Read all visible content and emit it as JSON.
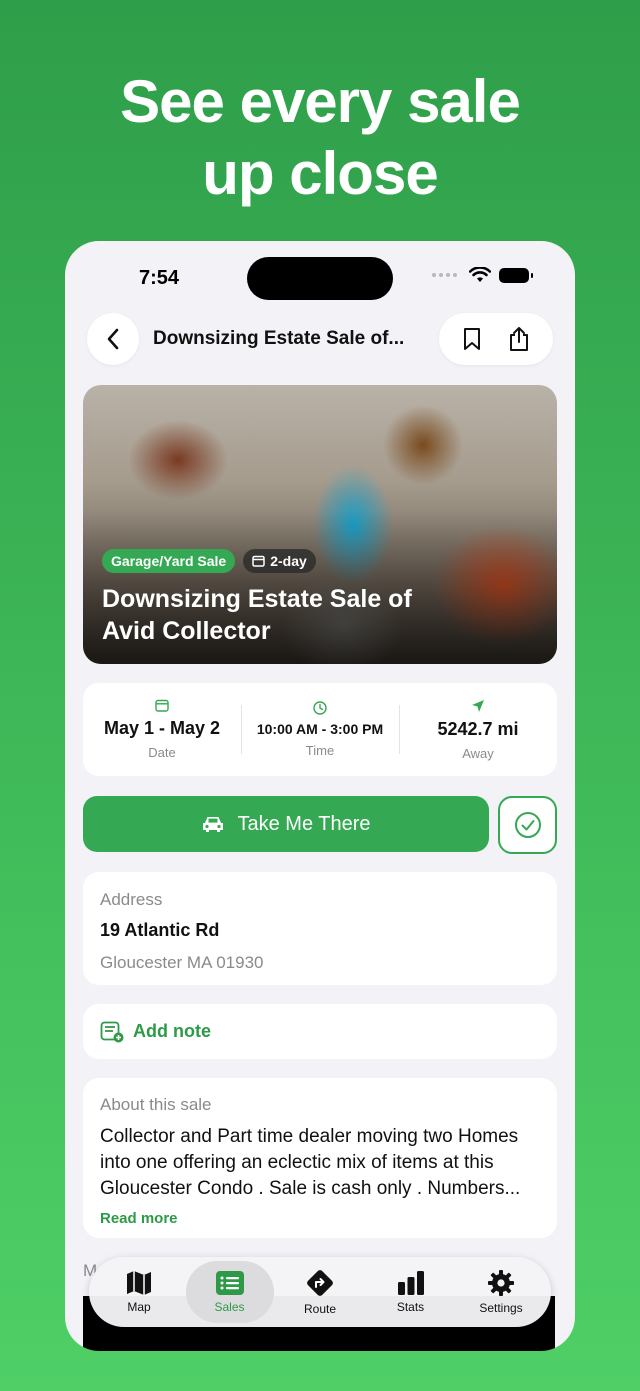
{
  "promo": {
    "line1": "See every sale",
    "line2": "up close"
  },
  "status_bar": {
    "time": "7:54"
  },
  "nav": {
    "title": "Downsizing Estate Sale of..."
  },
  "hero": {
    "category_tag": "Garage/Yard Sale",
    "duration_tag": "2-day",
    "title": "Downsizing Estate Sale of Avid Collector"
  },
  "info": {
    "date_value": "May 1 - May 2",
    "date_label": "Date",
    "time_value": "10:00 AM - 3:00 PM",
    "time_label": "Time",
    "distance_value": "5242.7 mi",
    "distance_label": "Away"
  },
  "actions": {
    "take_me_there": "Take Me There"
  },
  "address": {
    "label": "Address",
    "line1": "19 Atlantic Rd",
    "line2": "Gloucester MA 01930"
  },
  "note": {
    "label": "Add note"
  },
  "about": {
    "label": "About this sale",
    "text": "Collector and Part time dealer moving two Homes into one offering an eclectic mix of items at this Gloucester Condo . Sale is cash only . Numbers...",
    "read_more": "Read more"
  },
  "peek": {
    "label": "M"
  },
  "tabbar": {
    "tabs": [
      {
        "label": "Map",
        "icon": "map-icon"
      },
      {
        "label": "Sales",
        "icon": "list-icon",
        "active": true
      },
      {
        "label": "Route",
        "icon": "route-icon"
      },
      {
        "label": "Stats",
        "icon": "stats-icon"
      },
      {
        "label": "Settings",
        "icon": "gear-icon"
      }
    ]
  },
  "colors": {
    "brand_green": "#34a853",
    "text_green": "#2e9a47",
    "background": "#f2f2f7"
  }
}
